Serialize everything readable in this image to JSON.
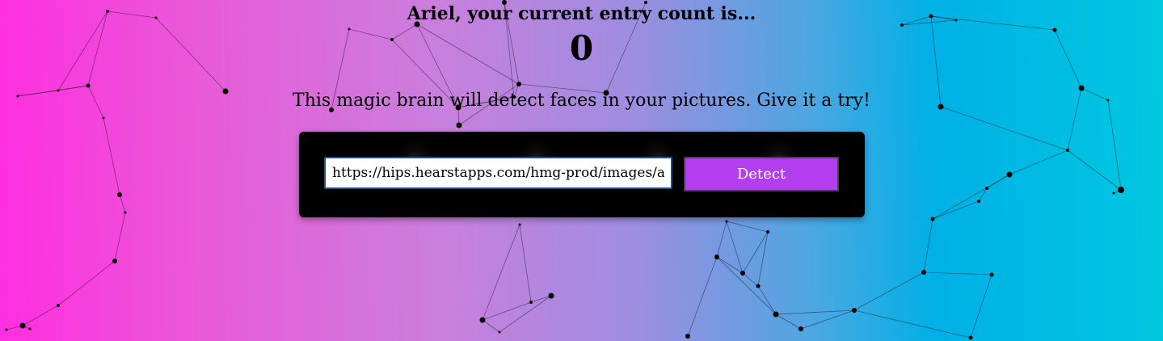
{
  "entry": {
    "title": "Ariel, your current entry count is...",
    "count": "0"
  },
  "tagline": "This magic brain will detect faces in your pictures. Give it a try!",
  "form": {
    "url_value": "https://hips.hearstapps.com/hmg-prod/images/actor-te",
    "detect_label": "Detect"
  },
  "colors": {
    "gradient_left": "#ff2ee0",
    "gradient_mid": "#9c8ee0",
    "gradient_right": "#00c8e0",
    "panel_bg": "#000000",
    "button_bg": "#b53df0",
    "input_border": "#1d4f9a"
  }
}
